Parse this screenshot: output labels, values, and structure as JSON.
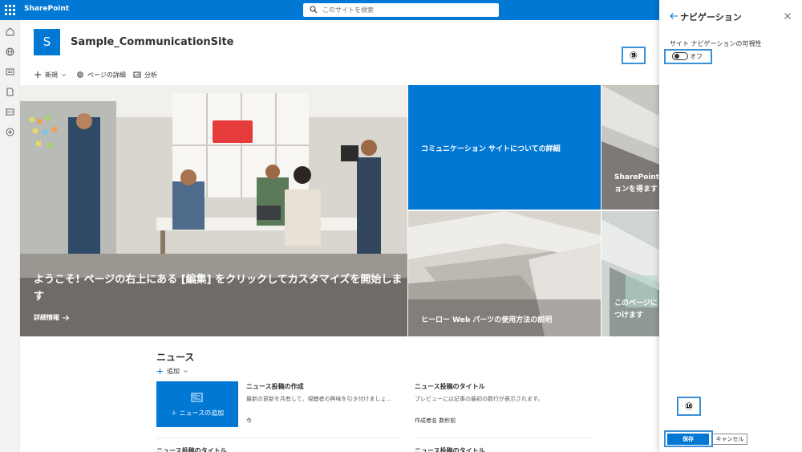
{
  "suite": {
    "brand": "SharePoint",
    "search_placeholder": "このサイトを検索"
  },
  "rail": {
    "icons": [
      "home-icon",
      "globe-icon",
      "news-icon",
      "document-icon",
      "list-icon",
      "add-icon"
    ]
  },
  "site": {
    "logo_letter": "S",
    "title": "Sample_CommunicationSite"
  },
  "commands": {
    "new": "新規",
    "page_details": "ページの詳細",
    "analytics": "分析"
  },
  "hero": {
    "main_caption": "ようこそ! ページの右上にある [編集] をクリックしてカスタマイズを開始します",
    "main_link": "詳細情報",
    "tile2_caption": "コミュニケーション サイトについての詳細",
    "tile3_caption": "SharePoint ア\nョンを得ます",
    "tile4_caption": "ヒーロー Web パーツの使用方法の説明",
    "tile5_caption": "このページに\nつけます"
  },
  "news": {
    "title": "ニュース",
    "add": "追加",
    "card_label": "ニュースの追加",
    "post1_title": "ニュース投稿の作成",
    "post1_desc": "最新の更新を共有して、視聴者の興味を引き付けましょ...",
    "post1_meta": "今",
    "post2_title": "ニュース投稿のタイトル",
    "post2_desc": "プレビューには記事の最初の数行が表示されます。",
    "post2_meta": "作成者名  数秒前",
    "post3_title": "ニュース投稿のタイトル",
    "post4_title": "ニュース投稿のタイトル"
  },
  "panel": {
    "title": "ナビゲーション",
    "visibility_label": "サイト ナビゲーションの可視性",
    "toggle_state": "オフ",
    "save": "保存",
    "cancel": "キャンセル"
  },
  "callouts": {
    "toggle_step": "⑨",
    "save_step": "⑩"
  },
  "colors": {
    "accent": "#0078d4",
    "callout": "#3b8fd9"
  }
}
